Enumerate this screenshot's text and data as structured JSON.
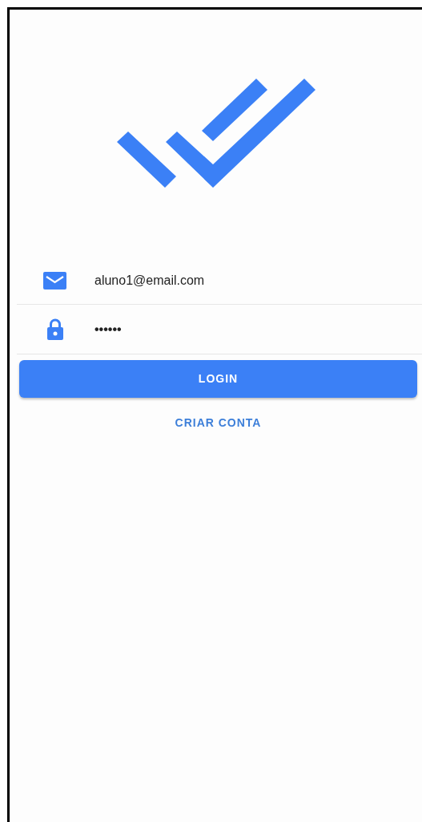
{
  "fields": [
    {
      "kind": "email",
      "value": "aluno1@email.com"
    },
    {
      "kind": "password",
      "value": "••••••"
    }
  ],
  "login_button": "LOGIN",
  "create_account_link": "CRIAR CONTA"
}
